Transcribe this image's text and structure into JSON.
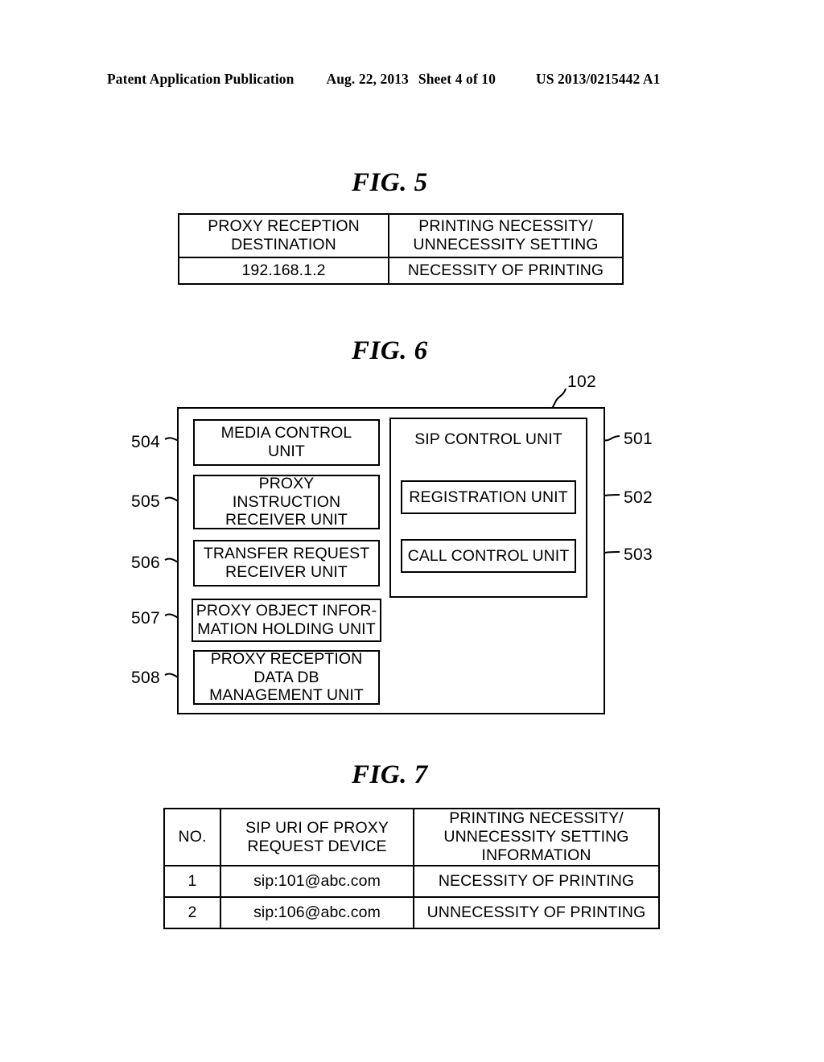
{
  "header": {
    "publication": "Patent Application Publication",
    "date": "Aug. 22, 2013",
    "sheet": "Sheet 4 of 10",
    "patent_number": "US 2013/0215442 A1"
  },
  "figures": {
    "fig5": {
      "title": "FIG. 5",
      "type": "table",
      "columns": [
        "PROXY RECEPTION\nDESTINATION",
        "PRINTING NECESSITY/\nUNNECESSITY SETTING"
      ],
      "rows": [
        [
          "192.168.1.2",
          "NECESSITY OF PRINTING"
        ]
      ]
    },
    "fig6": {
      "title": "FIG. 6",
      "type": "block-diagram",
      "outer_ref": "102",
      "left_blocks": [
        {
          "ref": "504",
          "label": "MEDIA CONTROL\nUNIT"
        },
        {
          "ref": "505",
          "label": "PROXY\nINSTRUCTION\nRECEIVER UNIT"
        },
        {
          "ref": "506",
          "label": "TRANSFER REQUEST\nRECEIVER UNIT"
        },
        {
          "ref": "507",
          "label": "PROXY OBJECT INFOR-\nMATION HOLDING UNIT"
        },
        {
          "ref": "508",
          "label": "PROXY RECEPTION\nDATA DB\nMANAGEMENT UNIT"
        }
      ],
      "right_group": {
        "ref": "501",
        "label": "SIP CONTROL UNIT",
        "children": [
          {
            "ref": "502",
            "label": "REGISTRATION UNIT"
          },
          {
            "ref": "503",
            "label": "CALL CONTROL UNIT"
          }
        ]
      }
    },
    "fig7": {
      "title": "FIG. 7",
      "type": "table",
      "columns": [
        "NO.",
        "SIP URI OF PROXY\nREQUEST DEVICE",
        "PRINTING NECESSITY/\nUNNECESSITY SETTING\nINFORMATION"
      ],
      "rows": [
        [
          "1",
          "sip:101@abc.com",
          "NECESSITY OF PRINTING"
        ],
        [
          "2",
          "sip:106@abc.com",
          "UNNECESSITY OF PRINTING"
        ]
      ]
    }
  }
}
